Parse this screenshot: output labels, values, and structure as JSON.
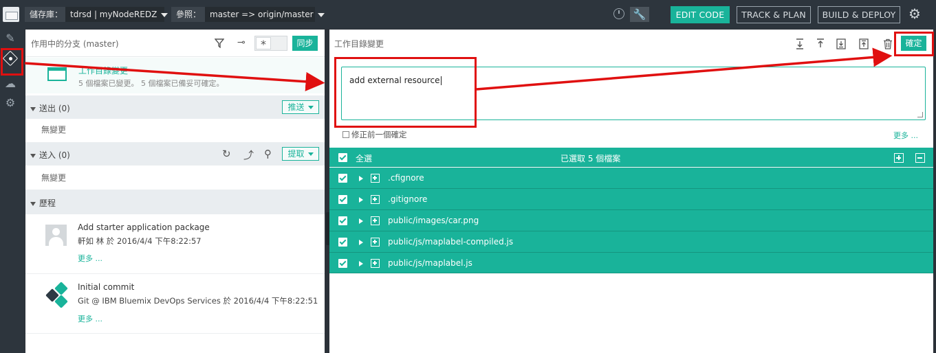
{
  "topbar": {
    "repo_label": "儲存庫：",
    "repo_value": "tdrsd | myNodeREDZ",
    "ref_label": "參照：",
    "ref_value": "master => origin/master",
    "edit_code": "EDIT CODE",
    "track_plan": "TRACK & PLAN",
    "build_deploy": "BUILD & DEPLOY"
  },
  "left": {
    "title": "作用中的分支 (master)",
    "sync_label": "同步",
    "toggle_symbol": "*",
    "working_dir": {
      "title": "工作目錄變更",
      "subtitle": "5 個檔案已變更。 5 個檔案已備妥可確定。"
    },
    "outgoing": {
      "label": "送出 (0)",
      "button": "推送",
      "empty": "無變更"
    },
    "incoming": {
      "label": "送入 (0)",
      "button": "提取",
      "empty": "無變更"
    },
    "history": {
      "label": "歷程",
      "commits": [
        {
          "title": "Add starter application package",
          "meta": "軒如 林 於 2016/4/4 下午8:22:57",
          "more": "更多 ..."
        },
        {
          "title": "Initial commit",
          "meta": "Git @ IBM Bluemix DevOps Services 於 2016/4/4 下午8:22:51",
          "more": "更多 ..."
        }
      ]
    }
  },
  "right": {
    "title": "工作目錄變更",
    "commit_button": "確定",
    "message": "add external resource",
    "amend_label": "修正前一個確定",
    "more": "更多 ...",
    "select_all": "全選",
    "selected_count": "已選取 5 個檔案",
    "files": [
      ".cfignore",
      ".gitignore",
      "public/images/car.png",
      "public/js/maplabel-compiled.js",
      "public/js/maplabel.js"
    ]
  },
  "colors": {
    "accent": "#19b39a",
    "annotation": "#e01010",
    "chrome": "#2d353d"
  }
}
